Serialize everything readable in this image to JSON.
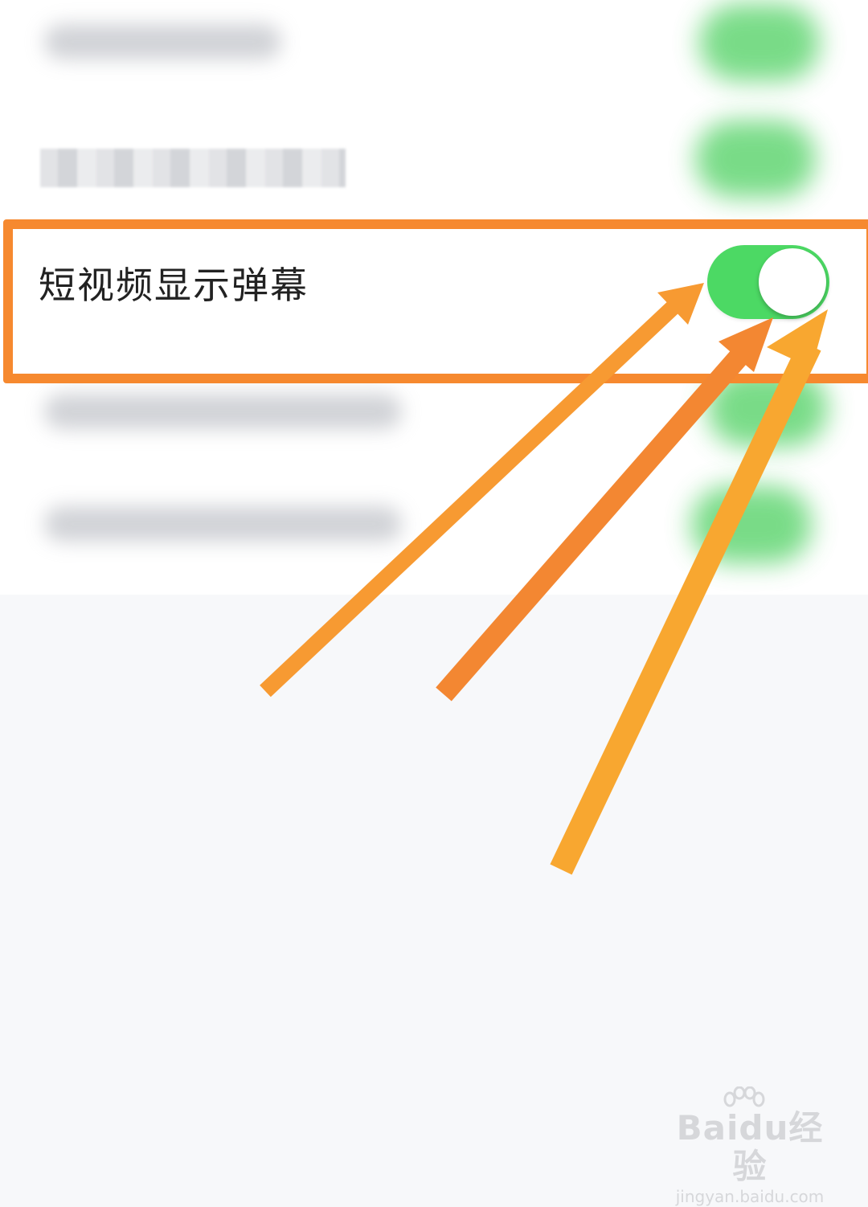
{
  "settings": {
    "highlighted_item": {
      "label": "短视频显示弹幕",
      "toggle_on": true
    }
  },
  "colors": {
    "highlight_border": "#f6892f",
    "toggle_on": "#4cd964",
    "arrow_light": "#f79a32",
    "arrow_mid": "#f38732",
    "arrow_yellow": "#f8a730"
  },
  "watermark": {
    "brand": "Baidu经验",
    "site": "jingyan.baidu.com"
  }
}
